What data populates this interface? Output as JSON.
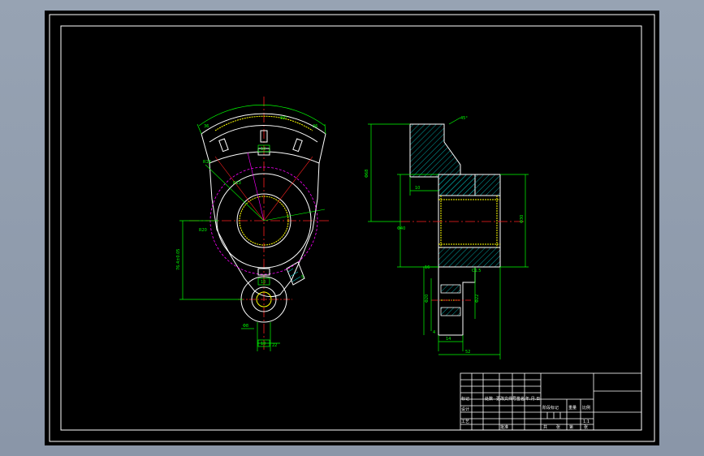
{
  "viewport": {
    "description_label": "CAD drawing viewport",
    "background": "#000000",
    "frame_color": "#ffffff"
  },
  "colors": {
    "outline": "#ffffff",
    "centerline": "#ff2020",
    "dimension": "#00ff00",
    "hidden": "#ff00ff",
    "hatch": "#00c8c8",
    "bore": "#ffff00",
    "magenta": "#ff00ff"
  },
  "front_view": {
    "dims": {
      "d_top_left": "36",
      "d_top_mid": "60°",
      "d_top_right": "36",
      "d_side_vertical": "76.4±0.05",
      "d_diag_left": "R18",
      "d_diag_left2": "R13",
      "d_left_radius": "R20",
      "d_bottom_hole": "Φ8",
      "d_bottom_width": "22",
      "d_top_small": "10",
      "d_mid_small": "10",
      "d_bottom_small": "10",
      "d_right_slot": "5"
    }
  },
  "side_view": {
    "dims": {
      "d_angle": "45°",
      "d_left_height": "Φ68",
      "d_mid_height": "Φ40",
      "d_right_height": "Φ30",
      "d_top_small": "10",
      "d_step": "16",
      "d_base_width": "52",
      "d_bottom_w1": "4",
      "d_bottom_w2": "14",
      "d_lower_left": "Φ20",
      "d_lower_right": "Φ22",
      "d_chamfer": "C1.5"
    }
  },
  "title_block": {
    "labels": [
      "标记",
      "处数",
      "更改文件号",
      "签名",
      "年.月.日"
    ],
    "row_design": "设计",
    "row_process": "工艺",
    "row_approve": "批准",
    "stage_label": "阶段标记",
    "weight_label": "重量",
    "scale_label": "比例",
    "scale_value": "1:1",
    "sheet_text": [
      "共",
      "张",
      "第",
      "张"
    ]
  }
}
